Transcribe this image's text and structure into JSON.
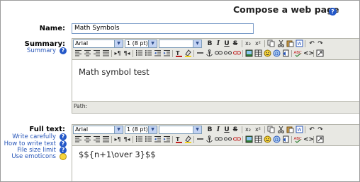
{
  "header": {
    "title": "Compose a web page",
    "help_icon": "help-icon"
  },
  "name_field": {
    "label": "Name:",
    "value": "Math Symbols"
  },
  "summary": {
    "label": "Summary:",
    "help_link": "Summary",
    "font_family": "Arial",
    "font_size": "1 (8 pt)",
    "format": "",
    "content": "Math symbol test",
    "path_label": "Path:"
  },
  "fulltext": {
    "label": "Full text:",
    "help_links": [
      "Write carefully",
      "How to write text",
      "File size limit",
      "Use emoticons"
    ],
    "font_family": "Arial",
    "font_size": "1 (8 pt)",
    "format": "",
    "content": "$${n+1\\over 3}$$"
  },
  "toolbar": {
    "row1": {
      "bold": "B",
      "italic": "I",
      "underline": "U",
      "strike": "S",
      "subscript": "x₂",
      "superscript": "x²",
      "undo": "↶",
      "redo": "↷"
    },
    "row2": {
      "ltr": "▸¶",
      "rtl": "¶◂",
      "html_source": "<>"
    }
  },
  "colors": {
    "link": "#2856b8",
    "toolbar_bg": "#e8e8e3",
    "help_icon": "#2458c8"
  }
}
